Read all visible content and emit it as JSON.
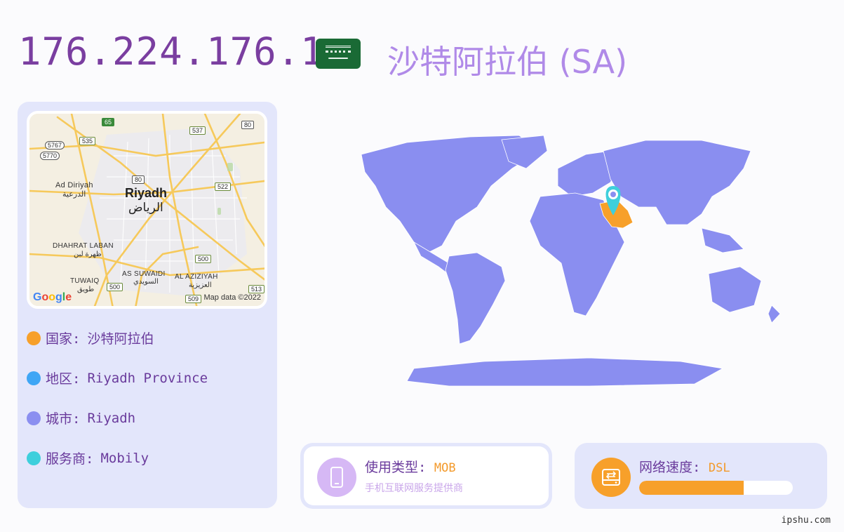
{
  "header": {
    "ip": "176.224.176.1",
    "country_title": "沙特阿拉伯 (SA)",
    "flag_icon": "saudi-arabia-flag"
  },
  "map": {
    "city_name_en": "Riyadh",
    "city_name_ar": "الرياض",
    "places": [
      {
        "en": "Ad Diriyah",
        "ar": "الدرعية"
      },
      {
        "en": "DHAHRAT LABAN",
        "ar": "ظهرة لبن"
      },
      {
        "en": "AS SUWAIDI",
        "ar": "السويدي"
      },
      {
        "en": "TUWAIQ",
        "ar": "طويق"
      },
      {
        "en": "AL AZIZIYAH",
        "ar": "العزيزية"
      }
    ],
    "road_shields": [
      "65",
      "537",
      "80",
      "5767",
      "535",
      "5770",
      "80",
      "522",
      "500",
      "500",
      "513",
      "509"
    ],
    "logo": "Google",
    "credit": "Map data ©2022"
  },
  "info": [
    {
      "label": "国家:",
      "value": "沙特阿拉伯",
      "color": "#f7a02a"
    },
    {
      "label": "地区:",
      "value": "Riyadh Province",
      "color": "#3fa6f5"
    },
    {
      "label": "城市:",
      "value": "Riyadh",
      "color": "#8b8ff0"
    },
    {
      "label": "服务商:",
      "value": "Mobily",
      "color": "#3ecfdc"
    }
  ],
  "usage_type": {
    "label": "使用类型:",
    "value": "MOB",
    "description": "手机互联网服务提供商",
    "icon": "mobile-phone-icon",
    "icon_bg": "#d6b8f5"
  },
  "net_speed": {
    "label": "网络速度:",
    "value": "DSL",
    "progress": 0.68,
    "icon": "network-drive-icon",
    "icon_bg": "#f7a02a"
  },
  "colors": {
    "accent_purple": "#7a3ea0",
    "title_lilac": "#b08ae8",
    "world_land": "#8a8ef0",
    "highlight_country": "#f7a02a",
    "pin": "#3ecfdc"
  },
  "watermark": "ipshu.com"
}
